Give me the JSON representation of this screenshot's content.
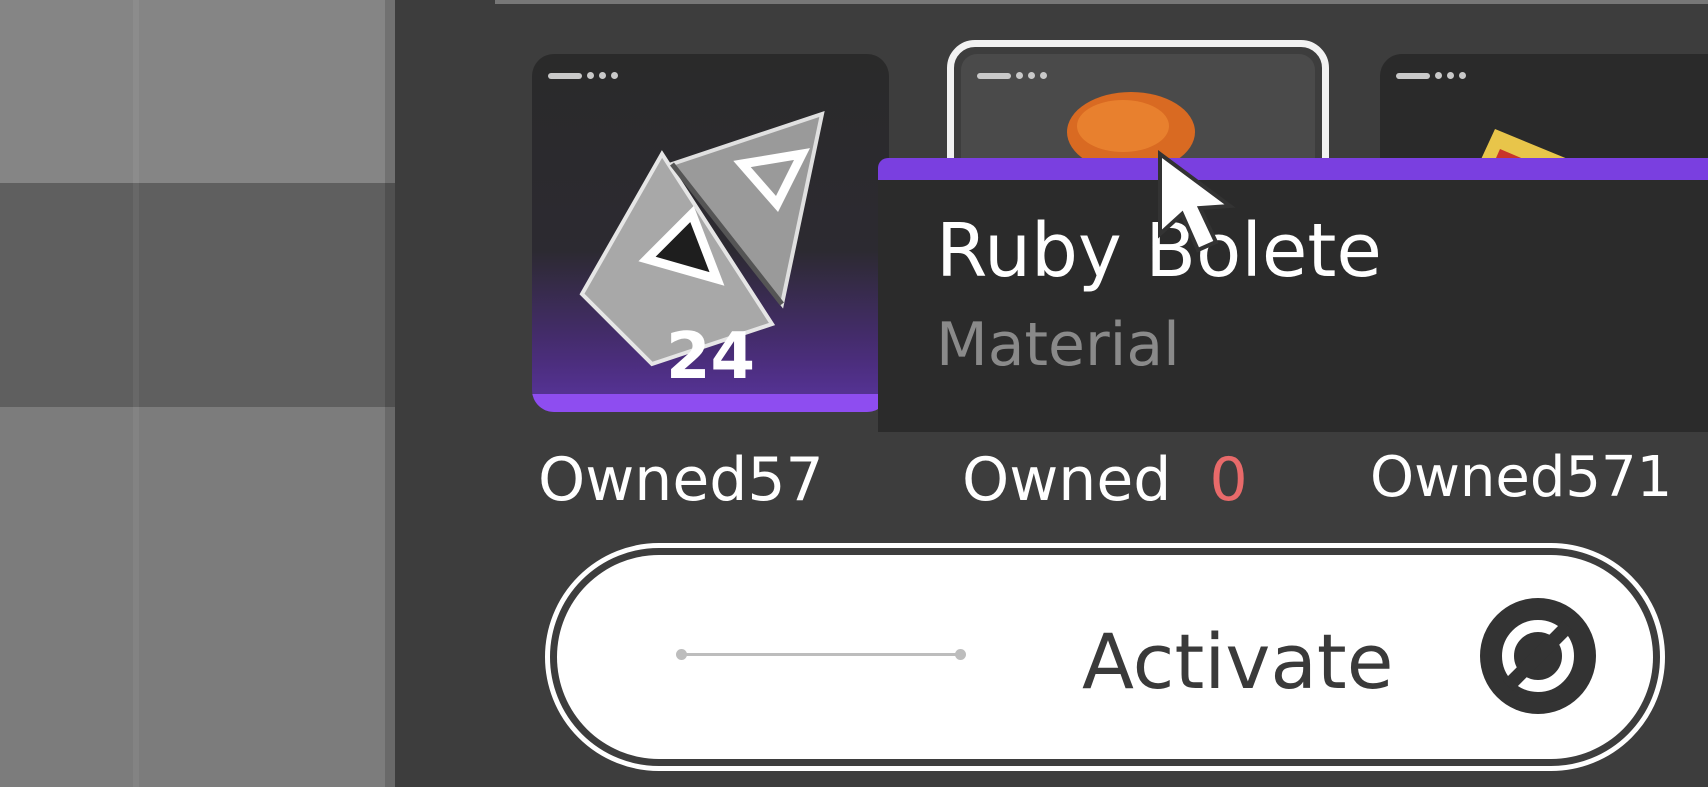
{
  "items": [
    {
      "count": "24",
      "owned_label": "Owned",
      "owned_value": "57",
      "rarity_color": "#8e4df0",
      "icon": "triangle-chip-icon"
    },
    {
      "owned_label": "Owned",
      "owned_value": "0",
      "selected": true,
      "rarity_color": "#8e4df0",
      "icon": "ruby-bolete-icon"
    },
    {
      "owned_label": "Owned",
      "owned_value": "571",
      "rarity_color": "#8e4df0",
      "icon": "folded-item-icon"
    }
  ],
  "tooltip": {
    "name": "Ruby Bolete",
    "type": "Material",
    "accent_color": "#7a3fe0"
  },
  "activate_button": {
    "label": "Activate",
    "icon": "refresh-circle-icon"
  },
  "colors": {
    "insufficient": "#e86a6a"
  }
}
